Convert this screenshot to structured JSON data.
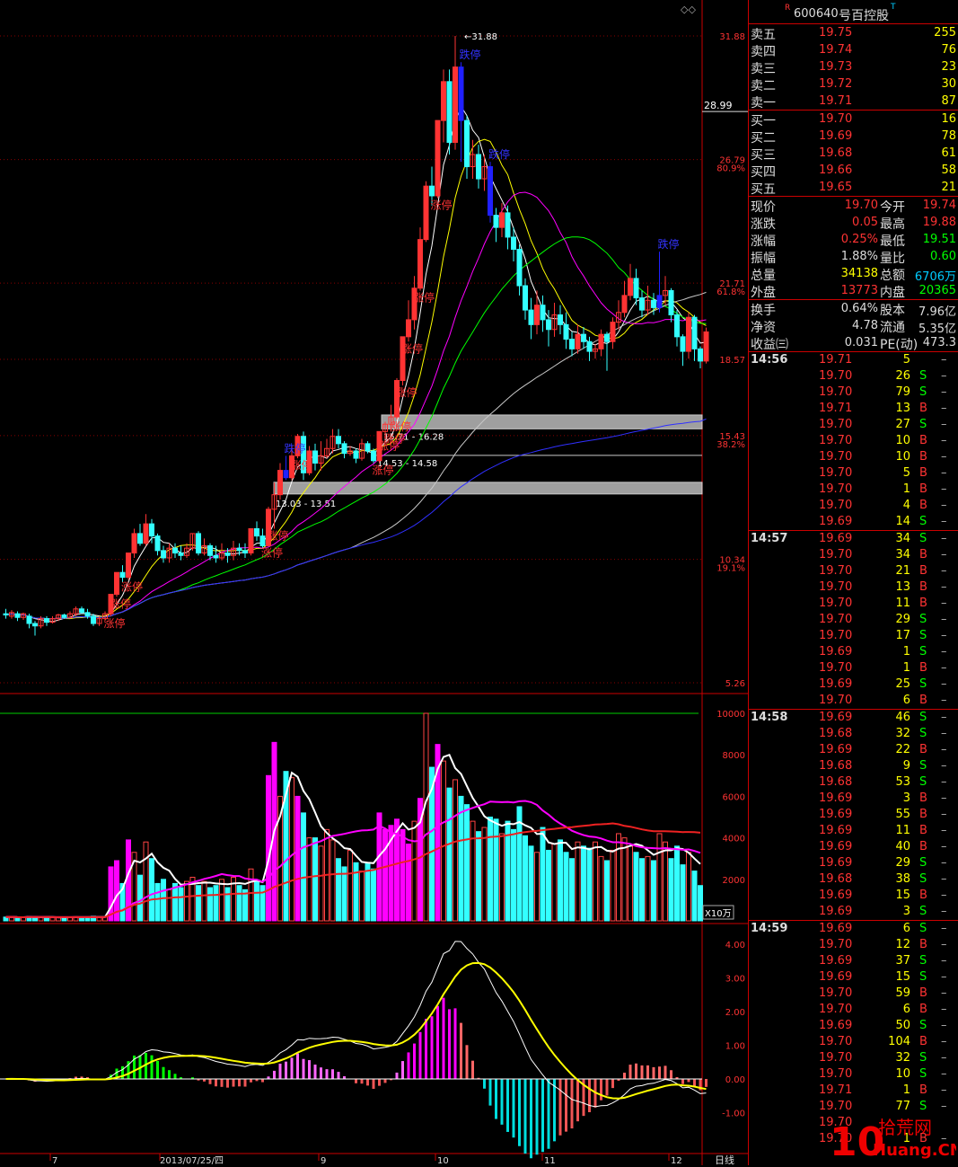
{
  "stock": {
    "code": "600640",
    "name": "号百控股",
    "r_mark": "R",
    "t_mark": "T"
  },
  "colors": {
    "up": "#ff3333",
    "down": "#33ffff",
    "ma5": "#ffffff",
    "ma10": "#ffff00",
    "ma20": "#ff00ff",
    "ma30": "#00ff00",
    "ma60": "#c8c8c8",
    "ma120": "#3030ff",
    "grid": "#880000",
    "zone": "#c8c8c8"
  },
  "main": {
    "y_ticks": [
      {
        "price": 31.88,
        "label": "31.88",
        "pct": ""
      },
      {
        "price": 26.79,
        "label": "26.79",
        "pct": "80.9%"
      },
      {
        "price": 21.71,
        "label": "21.71",
        "pct": "61.8%"
      },
      {
        "price": 18.57,
        "label": "18.57",
        "pct": ""
      },
      {
        "price": 15.43,
        "label": "15.43",
        "pct": "38.2%"
      },
      {
        "price": 10.34,
        "label": "10.34",
        "pct": "19.1%"
      },
      {
        "price": 5.26,
        "label": "5.26",
        "pct": ""
      }
    ],
    "current_price_label": "28.99",
    "high_label": "31.88",
    "zones": [
      {
        "lo": 15.71,
        "hi": 16.28,
        "label": "15.71 - 16.28"
      },
      {
        "lo": 14.53,
        "hi": 14.58,
        "label": "14.53 - 14.58"
      },
      {
        "lo": 13.03,
        "hi": 13.51,
        "label": "13.03 - 13.51"
      }
    ],
    "limit_up_label": "涨停",
    "limit_down_label": "跌停"
  },
  "volume": {
    "y_ticks": [
      "10000",
      "8000",
      "6000",
      "4000",
      "2000"
    ],
    "unit": "X10万"
  },
  "macd": {
    "y_ticks": [
      "4.00",
      "3.00",
      "2.00",
      "1.00",
      "0.00",
      "-1.00"
    ]
  },
  "x_axis": {
    "labels": [
      "7",
      "2013/07/25/四",
      "9",
      "10",
      "11",
      "12"
    ],
    "period": "日线"
  },
  "order_book": {
    "sell": [
      {
        "label": "卖五",
        "price": "19.75",
        "vol": "255"
      },
      {
        "label": "卖四",
        "price": "19.74",
        "vol": "76"
      },
      {
        "label": "卖三",
        "price": "19.73",
        "vol": "23"
      },
      {
        "label": "卖二",
        "price": "19.72",
        "vol": "30"
      },
      {
        "label": "卖一",
        "price": "19.71",
        "vol": "87"
      }
    ],
    "buy": [
      {
        "label": "买一",
        "price": "19.70",
        "vol": "16"
      },
      {
        "label": "买二",
        "price": "19.69",
        "vol": "78"
      },
      {
        "label": "买三",
        "price": "19.68",
        "vol": "61"
      },
      {
        "label": "买四",
        "price": "19.66",
        "vol": "58"
      },
      {
        "label": "买五",
        "price": "19.65",
        "vol": "21"
      }
    ]
  },
  "quote": [
    {
      "l1": "现价",
      "v1": "19.70",
      "c1": "#f33",
      "l2": "今开",
      "v2": "19.74",
      "c2": "#f33"
    },
    {
      "l1": "涨跌",
      "v1": "0.05",
      "c1": "#f33",
      "l2": "最高",
      "v2": "19.88",
      "c2": "#f33"
    },
    {
      "l1": "涨幅",
      "v1": "0.25%",
      "c1": "#f33",
      "l2": "最低",
      "v2": "19.51",
      "c2": "#0f0"
    },
    {
      "l1": "振幅",
      "v1": "1.88%",
      "c1": "#ddd",
      "l2": "量比",
      "v2": "0.60",
      "c2": "#0f0"
    },
    {
      "l1": "总量",
      "v1": "34138",
      "c1": "#ff0",
      "l2": "总额",
      "v2": "6706万",
      "c2": "#0cf"
    },
    {
      "l1": "外盘",
      "v1": "13773",
      "c1": "#f33",
      "l2": "内盘",
      "v2": "20365",
      "c2": "#0f0"
    },
    {
      "l1": "换手",
      "v1": "0.64%",
      "c1": "#ddd",
      "l2": "股本",
      "v2": "7.96亿",
      "c2": "#ddd"
    },
    {
      "l1": "净资",
      "v1": "4.78",
      "c1": "#ddd",
      "l2": "流通",
      "v2": "5.35亿",
      "c2": "#ddd"
    },
    {
      "l1": "收益㈢",
      "v1": "0.031",
      "c1": "#ddd",
      "l2": "PE(动)",
      "v2": "473.3",
      "c2": "#ddd"
    }
  ],
  "trades": [
    {
      "time": "14:56",
      "price": "19.71",
      "vol": "5",
      "side": "",
      "dash": "–"
    },
    {
      "time": "",
      "price": "19.70",
      "vol": "26",
      "side": "S",
      "dash": "–"
    },
    {
      "time": "",
      "price": "19.70",
      "vol": "79",
      "side": "S",
      "dash": "–"
    },
    {
      "time": "",
      "price": "19.71",
      "vol": "13",
      "side": "B",
      "dash": "–"
    },
    {
      "time": "",
      "price": "19.70",
      "vol": "27",
      "side": "S",
      "dash": "–"
    },
    {
      "time": "",
      "price": "19.70",
      "vol": "10",
      "side": "B",
      "dash": "–"
    },
    {
      "time": "",
      "price": "19.70",
      "vol": "10",
      "side": "B",
      "dash": "–"
    },
    {
      "time": "",
      "price": "19.70",
      "vol": "5",
      "side": "B",
      "dash": "–"
    },
    {
      "time": "",
      "price": "19.70",
      "vol": "1",
      "side": "B",
      "dash": "–"
    },
    {
      "time": "",
      "price": "19.70",
      "vol": "4",
      "side": "B",
      "dash": "–"
    },
    {
      "time": "",
      "price": "19.69",
      "vol": "14",
      "side": "S",
      "dash": "–"
    },
    {
      "time": "14:57",
      "price": "19.69",
      "vol": "34",
      "side": "S",
      "dash": "–"
    },
    {
      "time": "",
      "price": "19.70",
      "vol": "34",
      "side": "B",
      "dash": "–"
    },
    {
      "time": "",
      "price": "19.70",
      "vol": "21",
      "side": "B",
      "dash": "–"
    },
    {
      "time": "",
      "price": "19.70",
      "vol": "13",
      "side": "B",
      "dash": "–"
    },
    {
      "time": "",
      "price": "19.70",
      "vol": "11",
      "side": "B",
      "dash": "–"
    },
    {
      "time": "",
      "price": "19.70",
      "vol": "29",
      "side": "S",
      "dash": "–"
    },
    {
      "time": "",
      "price": "19.70",
      "vol": "17",
      "side": "S",
      "dash": "–"
    },
    {
      "time": "",
      "price": "19.69",
      "vol": "1",
      "side": "S",
      "dash": "–"
    },
    {
      "time": "",
      "price": "19.70",
      "vol": "1",
      "side": "B",
      "dash": "–"
    },
    {
      "time": "",
      "price": "19.69",
      "vol": "25",
      "side": "S",
      "dash": "–"
    },
    {
      "time": "",
      "price": "19.70",
      "vol": "6",
      "side": "B",
      "dash": "–"
    },
    {
      "time": "14:58",
      "price": "19.69",
      "vol": "46",
      "side": "S",
      "dash": "–"
    },
    {
      "time": "",
      "price": "19.68",
      "vol": "32",
      "side": "S",
      "dash": "–"
    },
    {
      "time": "",
      "price": "19.69",
      "vol": "22",
      "side": "B",
      "dash": "–"
    },
    {
      "time": "",
      "price": "19.68",
      "vol": "9",
      "side": "S",
      "dash": "–"
    },
    {
      "time": "",
      "price": "19.68",
      "vol": "53",
      "side": "S",
      "dash": "–"
    },
    {
      "time": "",
      "price": "19.69",
      "vol": "3",
      "side": "B",
      "dash": "–"
    },
    {
      "time": "",
      "price": "19.69",
      "vol": "55",
      "side": "B",
      "dash": "–"
    },
    {
      "time": "",
      "price": "19.69",
      "vol": "11",
      "side": "B",
      "dash": "–"
    },
    {
      "time": "",
      "price": "19.69",
      "vol": "40",
      "side": "B",
      "dash": "–"
    },
    {
      "time": "",
      "price": "19.69",
      "vol": "29",
      "side": "S",
      "dash": "–"
    },
    {
      "time": "",
      "price": "19.68",
      "vol": "38",
      "side": "S",
      "dash": "–"
    },
    {
      "time": "",
      "price": "19.69",
      "vol": "15",
      "side": "B",
      "dash": "–"
    },
    {
      "time": "",
      "price": "19.69",
      "vol": "3",
      "side": "S",
      "dash": "–"
    },
    {
      "time": "14:59",
      "price": "19.69",
      "vol": "6",
      "side": "S",
      "dash": "–"
    },
    {
      "time": "",
      "price": "19.70",
      "vol": "12",
      "side": "B",
      "dash": "–"
    },
    {
      "time": "",
      "price": "19.69",
      "vol": "37",
      "side": "S",
      "dash": "–"
    },
    {
      "time": "",
      "price": "19.69",
      "vol": "15",
      "side": "S",
      "dash": "–"
    },
    {
      "time": "",
      "price": "19.70",
      "vol": "59",
      "side": "B",
      "dash": "–"
    },
    {
      "time": "",
      "price": "19.70",
      "vol": "6",
      "side": "B",
      "dash": "–"
    },
    {
      "time": "",
      "price": "19.69",
      "vol": "50",
      "side": "S",
      "dash": "–"
    },
    {
      "time": "",
      "price": "19.70",
      "vol": "104",
      "side": "B",
      "dash": "–"
    },
    {
      "time": "",
      "price": "19.70",
      "vol": "32",
      "side": "S",
      "dash": "–"
    },
    {
      "time": "",
      "price": "19.70",
      "vol": "10",
      "side": "S",
      "dash": "–"
    },
    {
      "time": "",
      "price": "19.71",
      "vol": "1",
      "side": "B",
      "dash": "–"
    },
    {
      "time": "",
      "price": "19.70",
      "vol": "77",
      "side": "S",
      "dash": "–"
    },
    {
      "time": "",
      "price": "19.70",
      "vol": "",
      "side": "",
      "dash": ""
    },
    {
      "time": "",
      "price": "19.70",
      "vol": "1",
      "side": "B",
      "dash": "–"
    }
  ],
  "watermark": {
    "big": "10",
    "text1": "拾荒网",
    "text2": "Huang.CN"
  },
  "chart_data": {
    "type": "candlestick",
    "ylim": [
      5.26,
      31.88
    ],
    "candles": [
      [
        8.1,
        8.05,
        8.3,
        7.9
      ],
      [
        8.0,
        8.15,
        8.25,
        7.9
      ],
      [
        8.1,
        7.95,
        8.2,
        7.8
      ],
      [
        7.95,
        8.1,
        8.15,
        7.85
      ],
      [
        8.0,
        7.7,
        8.1,
        7.5
      ],
      [
        7.7,
        7.6,
        7.8,
        7.2
      ],
      [
        7.6,
        7.9,
        8.0,
        7.5
      ],
      [
        7.9,
        7.75,
        8.0,
        7.6
      ],
      [
        7.75,
        7.9,
        8.0,
        7.7
      ],
      [
        7.9,
        8.05,
        8.1,
        7.8
      ],
      [
        8.05,
        7.95,
        8.1,
        7.9
      ],
      [
        7.95,
        8.1,
        8.2,
        7.9
      ],
      [
        8.1,
        8.3,
        8.4,
        8.0
      ],
      [
        8.3,
        8.15,
        8.4,
        8.1
      ],
      [
        8.15,
        8.0,
        8.3,
        7.9
      ],
      [
        8.0,
        7.7,
        8.1,
        7.6
      ],
      [
        7.7,
        7.9,
        8.0,
        7.6
      ],
      [
        7.9,
        8.1,
        8.2,
        7.8
      ],
      [
        8.1,
        8.9,
        8.9,
        8.0
      ],
      [
        8.9,
        9.8,
        9.8,
        8.8
      ],
      [
        9.8,
        9.6,
        10.1,
        9.4
      ],
      [
        9.6,
        10.6,
        10.6,
        9.5
      ],
      [
        10.6,
        11.4,
        11.6,
        10.4
      ],
      [
        11.4,
        11.0,
        11.8,
        10.9
      ],
      [
        11.0,
        11.8,
        12.2,
        10.9
      ],
      [
        11.8,
        11.3,
        12.0,
        11.0
      ],
      [
        11.3,
        10.7,
        11.4,
        10.5
      ],
      [
        10.7,
        10.4,
        10.9,
        10.2
      ],
      [
        10.4,
        10.8,
        11.0,
        10.2
      ],
      [
        10.8,
        10.6,
        11.0,
        10.4
      ],
      [
        10.6,
        10.5,
        10.9,
        10.3
      ],
      [
        10.5,
        10.8,
        11.0,
        10.4
      ],
      [
        10.8,
        11.4,
        11.4,
        10.7
      ],
      [
        11.4,
        10.6,
        11.5,
        10.5
      ],
      [
        10.6,
        10.9,
        11.2,
        10.5
      ],
      [
        10.9,
        10.5,
        11.0,
        10.3
      ],
      [
        10.5,
        10.4,
        10.9,
        10.2
      ],
      [
        10.4,
        10.6,
        11.0,
        10.3
      ],
      [
        10.6,
        10.5,
        10.8,
        10.2
      ],
      [
        10.5,
        10.8,
        11.1,
        10.3
      ],
      [
        10.8,
        10.7,
        11.0,
        10.5
      ],
      [
        10.7,
        10.6,
        11.0,
        10.4
      ],
      [
        10.6,
        11.6,
        11.6,
        10.5
      ],
      [
        11.6,
        11.3,
        11.9,
        11.1
      ],
      [
        11.3,
        10.9,
        11.6,
        10.8
      ],
      [
        10.9,
        12.4,
        12.5,
        10.9
      ],
      [
        12.4,
        13.0,
        13.5,
        11.6
      ],
      [
        13.0,
        14.0,
        14.3,
        12.8
      ],
      [
        14.0,
        13.7,
        14.6,
        13.6
      ],
      [
        13.7,
        14.6,
        15.0,
        13.6
      ],
      [
        14.6,
        15.4,
        15.5,
        14.5
      ],
      [
        15.4,
        13.9,
        15.6,
        13.6
      ],
      [
        13.9,
        14.8,
        15.0,
        13.8
      ],
      [
        14.8,
        14.3,
        15.1,
        14.0
      ],
      [
        14.3,
        14.6,
        15.2,
        14.0
      ],
      [
        14.6,
        14.9,
        15.3,
        14.5
      ],
      [
        14.9,
        15.4,
        15.7,
        14.7
      ],
      [
        15.4,
        15.1,
        15.7,
        14.9
      ],
      [
        15.1,
        14.7,
        15.2,
        14.5
      ],
      [
        14.7,
        14.8,
        15.0,
        14.6
      ],
      [
        14.8,
        14.5,
        14.9,
        14.3
      ],
      [
        14.5,
        15.1,
        15.3,
        14.4
      ],
      [
        15.1,
        14.8,
        15.2,
        14.7
      ],
      [
        14.8,
        14.4,
        14.9,
        14.3
      ],
      [
        14.4,
        15.6,
        15.6,
        14.3
      ],
      [
        15.6,
        15.9,
        16.0,
        15.3
      ],
      [
        15.9,
        16.2,
        16.7,
        15.6
      ],
      [
        16.2,
        17.7,
        17.8,
        16.1
      ],
      [
        17.7,
        19.5,
        19.5,
        17.5
      ],
      [
        19.5,
        20.2,
        21.0,
        19.3
      ],
      [
        20.2,
        21.5,
        22.0,
        19.8
      ],
      [
        21.5,
        23.5,
        24.0,
        21.4
      ],
      [
        23.5,
        25.7,
        25.9,
        23.4
      ],
      [
        25.7,
        25.3,
        26.5,
        24.9
      ],
      [
        25.3,
        28.4,
        28.4,
        25.2
      ],
      [
        28.4,
        30.0,
        30.5,
        27.5
      ],
      [
        30.0,
        27.5,
        30.5,
        27.0
      ],
      [
        27.5,
        30.6,
        31.88,
        27.2
      ],
      [
        30.6,
        28.4,
        30.8,
        26.7
      ],
      [
        28.4,
        26.5,
        28.6,
        26.0
      ],
      [
        26.5,
        27.0,
        27.6,
        26.0
      ],
      [
        27.0,
        26.0,
        27.4,
        25.6
      ],
      [
        26.0,
        26.5,
        27.0,
        25.5
      ],
      [
        26.5,
        24.5,
        26.7,
        24.2
      ],
      [
        24.5,
        24.0,
        24.8,
        23.4
      ],
      [
        24.0,
        24.6,
        25.0,
        23.6
      ],
      [
        24.6,
        23.6,
        24.9,
        23.1
      ],
      [
        23.6,
        23.1,
        24.0,
        22.6
      ],
      [
        23.1,
        21.6,
        23.3,
        21.2
      ],
      [
        21.6,
        20.6,
        21.9,
        20.2
      ],
      [
        20.6,
        20.0,
        21.1,
        19.4
      ],
      [
        20.0,
        20.8,
        21.4,
        19.6
      ],
      [
        20.8,
        20.2,
        21.2,
        19.7
      ],
      [
        20.2,
        19.8,
        20.6,
        19.1
      ],
      [
        19.8,
        20.4,
        20.9,
        19.5
      ],
      [
        20.4,
        20.0,
        20.8,
        19.6
      ],
      [
        20.0,
        19.4,
        20.5,
        19.0
      ],
      [
        19.4,
        19.0,
        19.7,
        18.7
      ],
      [
        19.0,
        19.6,
        20.0,
        18.8
      ],
      [
        19.6,
        19.3,
        19.9,
        19.0
      ],
      [
        19.3,
        18.9,
        19.5,
        18.5
      ],
      [
        18.9,
        19.0,
        19.2,
        18.6
      ],
      [
        19.0,
        19.6,
        19.8,
        18.7
      ],
      [
        19.6,
        19.3,
        19.7,
        18.1
      ],
      [
        19.3,
        20.1,
        20.3,
        19.0
      ],
      [
        20.1,
        20.5,
        21.0,
        19.8
      ],
      [
        20.5,
        21.2,
        21.8,
        20.3
      ],
      [
        21.2,
        21.9,
        22.5,
        21.0
      ],
      [
        21.9,
        21.1,
        22.3,
        20.8
      ],
      [
        21.1,
        20.6,
        21.4,
        20.3
      ],
      [
        20.6,
        21.0,
        21.6,
        20.4
      ],
      [
        21.0,
        20.7,
        21.3,
        20.4
      ],
      [
        20.7,
        21.2,
        23.0,
        20.5
      ],
      [
        21.2,
        21.4,
        22.0,
        20.8
      ],
      [
        21.4,
        20.4,
        21.5,
        20.1
      ],
      [
        20.4,
        19.5,
        20.6,
        19.1
      ],
      [
        19.5,
        18.9,
        19.6,
        18.3
      ],
      [
        18.9,
        20.3,
        20.5,
        18.6
      ],
      [
        20.3,
        19.0,
        20.4,
        18.5
      ],
      [
        19.0,
        18.5,
        19.1,
        18.2
      ],
      [
        18.5,
        19.7,
        19.88,
        18.4
      ]
    ],
    "limit_up_idx": [
      18,
      19,
      21,
      45,
      46,
      50,
      64,
      65,
      66,
      67,
      68,
      69,
      71,
      74
    ],
    "limit_down_idx": [
      48,
      78,
      83,
      112
    ],
    "volume": [
      180,
      200,
      150,
      170,
      210,
      190,
      160,
      180,
      170,
      150,
      190,
      180,
      200,
      170,
      150,
      220,
      180,
      190,
      2600,
      2900,
      1800,
      3900,
      3300,
      2200,
      3800,
      3000,
      1800,
      2000,
      1500,
      1800,
      1600,
      1900,
      2100,
      1700,
      1900,
      1600,
      1700,
      2000,
      1600,
      2100,
      1700,
      1500,
      2500,
      1900,
      1700,
      7000,
      8600,
      6000,
      7200,
      6900,
      6000,
      5200,
      4000,
      4000,
      3600,
      4400,
      3900,
      3000,
      2600,
      3400,
      2800,
      2400,
      2800,
      2500,
      5200,
      4400,
      4600,
      4900,
      4400,
      3700,
      4800,
      5900,
      10000,
      7400,
      8500,
      7700,
      6400,
      6800,
      6000,
      5600,
      4800,
      4300,
      4500,
      5000,
      4900,
      4200,
      4800,
      4400,
      5500,
      4100,
      3600,
      3300,
      4500,
      3400,
      3700,
      3900,
      3300,
      3000,
      3800,
      3600,
      3500,
      3800,
      3100,
      2900,
      3400,
      4200,
      4000,
      3600,
      3300,
      3000,
      3100,
      2900,
      4200,
      3800,
      3000,
      3600,
      2700,
      3300,
      2400,
      1700
    ],
    "vol_ylim": [
      0,
      10000
    ]
  }
}
